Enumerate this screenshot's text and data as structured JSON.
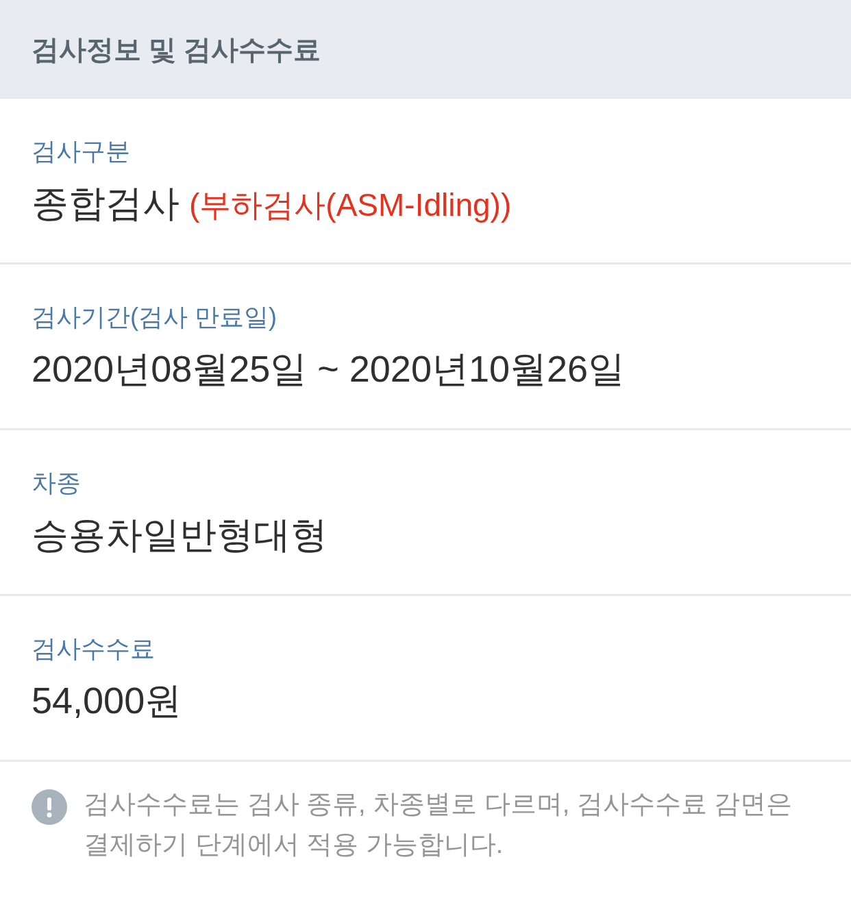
{
  "header": {
    "title": "검사정보 및 검사수수료"
  },
  "fields": [
    {
      "label": "검사구분",
      "value": "종합검사",
      "note": "(부하검사(ASM-Idling))"
    },
    {
      "label": "검사기간(검사 만료일)",
      "value": "2020년08월25일 ~ 2020년10월26일"
    },
    {
      "label": "차종",
      "value": "승용차일반형대형"
    },
    {
      "label": "검사수수료",
      "value": "54,000원"
    }
  ],
  "notice": {
    "text": "검사수수료는 검사 종류, 차종별로 다르며, 검사수수료 감면은 결제하기 단계에서 적용 가능합니다."
  }
}
